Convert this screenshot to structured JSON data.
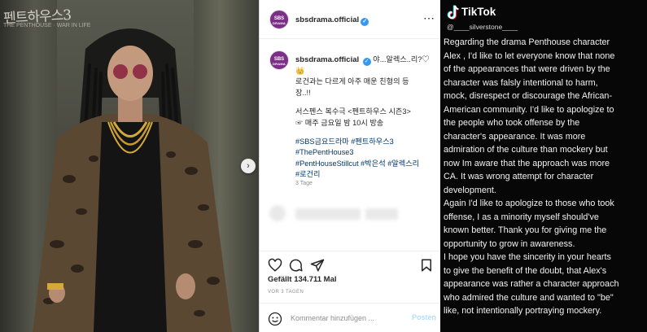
{
  "photo": {
    "watermark": "펜트하우스3",
    "watermark_sub": "THE PENTHOUSE · WAR IN LIFE"
  },
  "instagram": {
    "account": "sbsdrama.official",
    "avatar_text": "SBS",
    "avatar_sub": "DRAMA",
    "more_icon": "⋯",
    "caption_lines": [
      "야...알렉스..리?♡",
      "👑",
      "로건과는 다르게 아주 매운 친형의 등",
      "장..!!",
      "",
      "서스펜스 복수극 <펜트하우스 시즌3>",
      "☞ 매주 금요일 밤 10시 방송",
      ""
    ],
    "caption_first_inline": "야...알렉스..리?♡",
    "hashtag_lines": [
      "#SBS금요드라마 #펜트하우스3",
      "#ThePentHouse3",
      "#PentHouseStillcut #박은석 #알렉스리",
      "#로건리"
    ],
    "time_ago": "3 Tage",
    "likes": "Gefällt 134.711 Mal",
    "posted_ago": "VOR 3 TAGEN",
    "comment_placeholder": "Kommentar hinzufügen ...",
    "post_label": "Posten",
    "accent_color": "#3897f0",
    "icons": [
      "heart-icon",
      "comment-icon",
      "share-icon",
      "bookmark-icon",
      "emoji-icon"
    ]
  },
  "tiktok": {
    "brand": "TikTok",
    "handle": "@____silverstone____",
    "lines": [
      "Regarding the drama Penthouse character",
      "Alex , I'd like to let everyone know that none",
      "of the appearances that were driven by the",
      "character was falsly intentional to harm,",
      "mock, disrespect or discourage the African-",
      "American community. I'd like to apologize to",
      "the people who took offense by the",
      "character's appearance. It was more",
      "admiration of the culture than mockery but",
      "now Im aware that the approach was more",
      "CA. It was wrong attempt for character",
      "development.",
      "Again I'd like to apologize to those who took",
      "offense, I as a minority myself should've",
      "known better. Thank you for giving me the",
      "opportunity to grow in awareness.",
      "I hope you have the sincerity in your hearts",
      "to give the benefit of the doubt, that Alex's",
      "appearance was rather a character approach",
      "who admired the culture and wanted to \"be\"",
      "like, not intentionally portraying mockery."
    ]
  }
}
